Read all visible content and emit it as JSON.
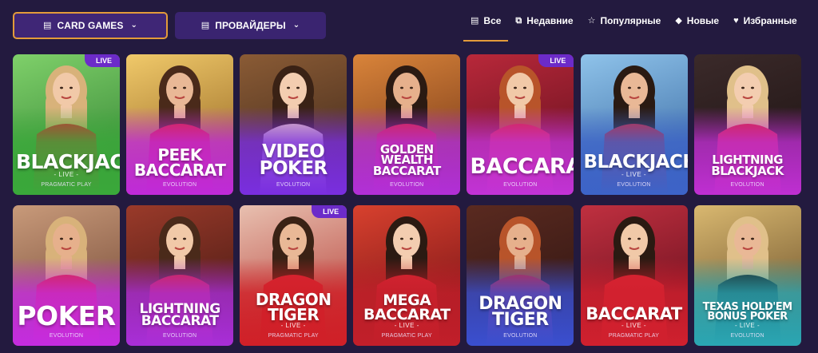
{
  "toolbar": {
    "category": {
      "label": "CARD GAMES",
      "icon": "list-icon"
    },
    "providers": {
      "label": "ПРОВАЙДЕРЫ",
      "icon": "list-icon"
    }
  },
  "tabs": [
    {
      "label": "Все",
      "icon": "list-icon",
      "active": true
    },
    {
      "label": "Недавние",
      "icon": "recent-icon",
      "active": false
    },
    {
      "label": "Популярные",
      "icon": "star-icon",
      "active": false
    },
    {
      "label": "Новые",
      "icon": "diamond-icon",
      "active": false
    },
    {
      "label": "Избранные",
      "icon": "heart-icon",
      "active": false
    }
  ],
  "games": [
    {
      "title": [
        "BLACKJACK"
      ],
      "sub": "- LIVE -",
      "provider": "PRAGMATIC PLAY",
      "live": true,
      "badge": "LIVE",
      "bg": [
        "#7fd06a",
        "#2d7d2f"
      ],
      "shade": "#3aa83a",
      "size": 25
    },
    {
      "title": [
        "PEEK",
        "BACCARAT"
      ],
      "sub": "",
      "provider": "EVOLUTION",
      "live": false,
      "badge": "",
      "bg": [
        "#f0c96a",
        "#8a5a1a"
      ],
      "shade": "#c02ad9",
      "size": 20
    },
    {
      "title": [
        "VIDEO",
        "POKER"
      ],
      "sub": "",
      "provider": "EVOLUTION",
      "live": false,
      "badge": "",
      "bg": [
        "#8a5b35",
        "#3a2418"
      ],
      "shade": "#7a2ee0",
      "size": 23
    },
    {
      "title": [
        "GOLDEN WEALTH",
        "BACCARAT"
      ],
      "sub": "",
      "provider": "EVOLUTION",
      "live": false,
      "badge": "",
      "bg": [
        "#d9843a",
        "#6a2f14"
      ],
      "shade": "#b22fd8",
      "size": 15
    },
    {
      "title": [
        "BACCARAT"
      ],
      "sub": "",
      "provider": "EVOLUTION",
      "live": true,
      "badge": "LIVE",
      "bg": [
        "#b8283a",
        "#5a0d1a"
      ],
      "shade": "#c233d6",
      "size": 27
    },
    {
      "title": [
        "BLACKJACK"
      ],
      "sub": "- LIVE -",
      "provider": "EVOLUTION",
      "live": false,
      "badge": "",
      "bg": [
        "#8fc3ea",
        "#2f5f9a"
      ],
      "shade": "#3d63c8",
      "size": 23
    },
    {
      "title": [
        "LIGHTNING",
        "BLACKJACK"
      ],
      "sub": "",
      "provider": "EVOLUTION",
      "live": false,
      "badge": "",
      "bg": [
        "#3b2a2a",
        "#1a1010"
      ],
      "shade": "#bf2fd2",
      "size": 15
    },
    {
      "title": [
        "POKER"
      ],
      "sub": "",
      "provider": "EVOLUTION",
      "live": false,
      "badge": "",
      "bg": [
        "#c89a7a",
        "#6a3f2e"
      ],
      "shade": "#c52ce0",
      "size": 33
    },
    {
      "title": [
        "LIGHTNING",
        "BACCARAT"
      ],
      "sub": "",
      "provider": "EVOLUTION",
      "live": false,
      "badge": "",
      "bg": [
        "#9a3a2a",
        "#3a1410"
      ],
      "shade": "#a92ed8",
      "size": 17
    },
    {
      "title": [
        "DRAGON",
        "TIGER"
      ],
      "sub": "- LIVE -",
      "provider": "PRAGMATIC PLAY",
      "live": true,
      "badge": "LIVE",
      "bg": [
        "#e8c0b0",
        "#b0302a"
      ],
      "shade": "#d02028",
      "size": 20
    },
    {
      "title": [
        "MEGA",
        "BACCARAT"
      ],
      "sub": "- LIVE -",
      "provider": "PRAGMATIC PLAY",
      "live": false,
      "badge": "",
      "bg": [
        "#d8412e",
        "#6a0d14"
      ],
      "shade": "#c21f2a",
      "size": 19
    },
    {
      "title": [
        "DRAGON",
        "TIGER"
      ],
      "sub": "",
      "provider": "EVOLUTION",
      "live": false,
      "badge": "",
      "bg": [
        "#5a2a20",
        "#2a1210"
      ],
      "shade": "#3a4fd0",
      "size": 22
    },
    {
      "title": [
        "BACCARAT"
      ],
      "sub": "- LIVE -",
      "provider": "PRAGMATIC PLAY",
      "live": false,
      "badge": "",
      "bg": [
        "#c03040",
        "#5a0a18"
      ],
      "shade": "#d0202e",
      "size": 21
    },
    {
      "title": [
        "TEXAS HOLD'EM",
        "BONUS POKER"
      ],
      "sub": "- LIVE -",
      "provider": "EVOLUTION",
      "live": false,
      "badge": "",
      "bg": [
        "#d9b870",
        "#5a4020"
      ],
      "shade": "#2aa6b3",
      "size": 13
    }
  ]
}
